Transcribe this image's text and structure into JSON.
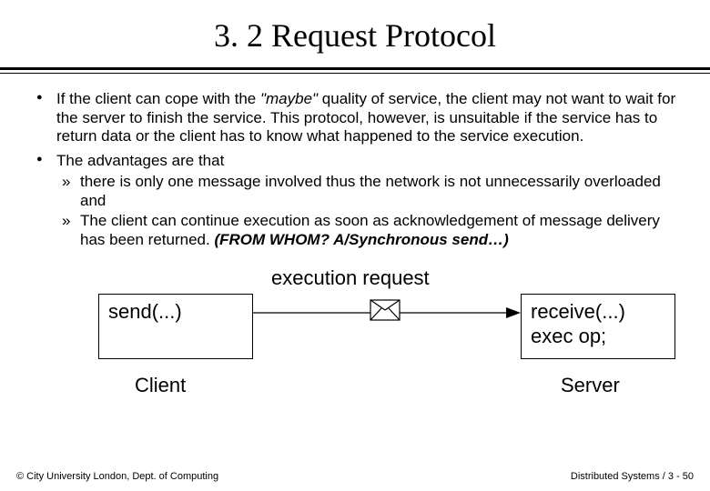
{
  "title": "3. 2 Request Protocol",
  "bullets": {
    "b1_pre": "If the client can cope with the ",
    "b1_q1": "\"maybe\"",
    "b1_post": " quality of service, the client may not want to wait for the server to finish the service. This protocol, however, is unsuitable if the service has to return data or the client has to know what happened to the service execution.",
    "b2": "The advantages are that",
    "b2a": "there is only one message involved thus the network is not unnecessarily overloaded and",
    "b2b_pre": "The client can continue execution as soon as acknowledgement of message delivery has been returned. ",
    "b2b_em": "(FROM WHOM? A/Synchronous send…)"
  },
  "diagram": {
    "exec_label": "execution request",
    "client_box": "send(...)",
    "server_box_l1": "receive(...)",
    "server_box_l2": "exec op;",
    "client_label": "Client",
    "server_label": "Server"
  },
  "footer": {
    "left": "© City University London, Dept. of Computing",
    "right": "Distributed Systems / 3 - 50"
  }
}
